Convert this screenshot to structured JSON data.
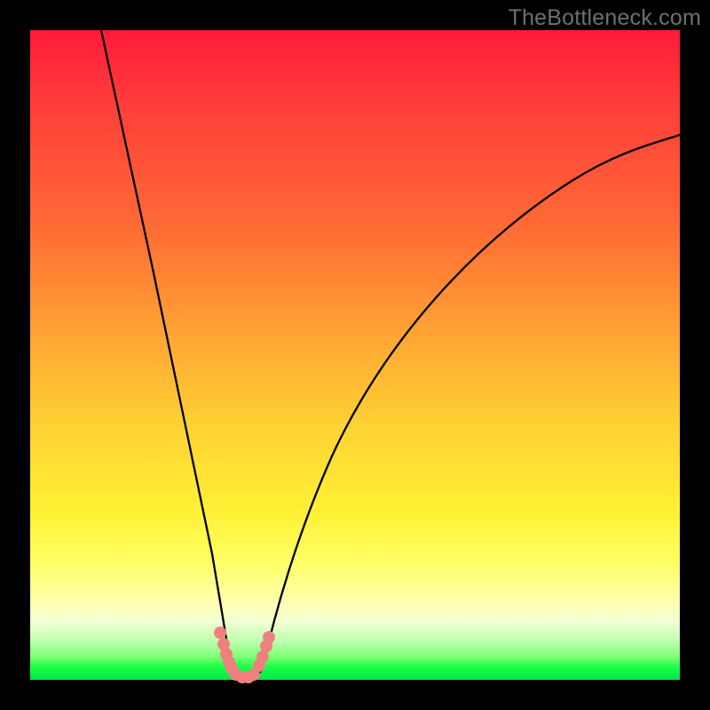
{
  "watermark": "TheBottleneck.com",
  "chart_data": {
    "type": "line",
    "title": "",
    "xlabel": "",
    "ylabel": "",
    "xlim": [
      0,
      100
    ],
    "ylim": [
      0,
      100
    ],
    "grid": false,
    "series": [
      {
        "name": "left-branch",
        "x": [
          11,
          14,
          17,
          20,
          23,
          25,
          27,
          28.5,
          29.5,
          30.2,
          30.8
        ],
        "y": [
          100,
          82,
          65,
          48,
          32,
          21,
          12,
          7,
          4,
          2,
          1
        ]
      },
      {
        "name": "right-branch",
        "x": [
          35,
          36.5,
          38.5,
          41,
          45,
          50,
          56,
          63,
          71,
          79,
          88,
          95,
          100
        ],
        "y": [
          1,
          3,
          7,
          13,
          22,
          32,
          42,
          52,
          61,
          69,
          76,
          81,
          84
        ]
      },
      {
        "name": "valley-floor",
        "x": [
          30.8,
          31.5,
          32.5,
          33.5,
          34.3,
          35
        ],
        "y": [
          1,
          0.3,
          0.1,
          0.1,
          0.3,
          1
        ]
      }
    ],
    "markers": [
      {
        "x": 29.3,
        "y": 7.2
      },
      {
        "x": 29.8,
        "y": 5.5
      },
      {
        "x": 30.2,
        "y": 4.0
      },
      {
        "x": 30.5,
        "y": 2.8
      },
      {
        "x": 30.9,
        "y": 1.8
      },
      {
        "x": 31.6,
        "y": 0.9
      },
      {
        "x": 32.5,
        "y": 0.5
      },
      {
        "x": 33.4,
        "y": 0.5
      },
      {
        "x": 34.2,
        "y": 0.9
      },
      {
        "x": 35.2,
        "y": 2.2
      },
      {
        "x": 35.7,
        "y": 3.6
      },
      {
        "x": 36.2,
        "y": 5.2
      },
      {
        "x": 36.7,
        "y": 6.6
      }
    ],
    "gradient_stops": [
      {
        "pos": 0,
        "color": "#ff1a3a"
      },
      {
        "pos": 30,
        "color": "#ff6a35"
      },
      {
        "pos": 62,
        "color": "#ffd534"
      },
      {
        "pos": 88,
        "color": "#ffffb0"
      },
      {
        "pos": 100,
        "color": "#00e84a"
      }
    ]
  }
}
